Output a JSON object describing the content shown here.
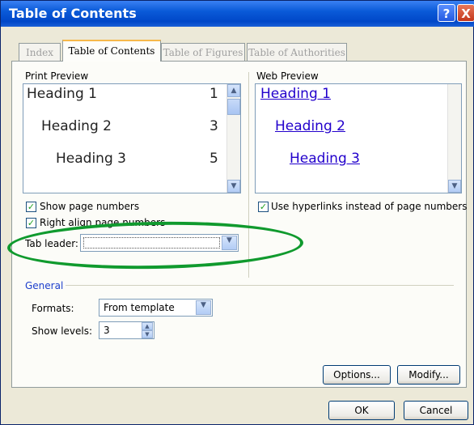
{
  "window": {
    "title": "Table of Contents"
  },
  "titlebar_buttons": {
    "help": "?",
    "close": "X"
  },
  "tabs": [
    {
      "label": "Index"
    },
    {
      "label": "Table of Contents"
    },
    {
      "label": "Table of Figures"
    },
    {
      "label": "Table of Authorities"
    }
  ],
  "print_preview": {
    "label": "Print Preview",
    "headings": [
      {
        "text": "Heading 1",
        "page": "1"
      },
      {
        "text": "Heading 2",
        "page": "3"
      },
      {
        "text": "Heading 3",
        "page": "5"
      }
    ]
  },
  "web_preview": {
    "label": "Web Preview",
    "headings": [
      "Heading 1",
      "Heading 2",
      "Heading 3"
    ]
  },
  "options": {
    "show_page_numbers": {
      "label": "Show page numbers",
      "checked": true
    },
    "right_align": {
      "label": "Right align page numbers",
      "checked": true
    },
    "use_hyperlinks": {
      "label": "Use hyperlinks instead of page numbers",
      "checked": true
    },
    "tab_leader": {
      "label": "Tab leader:",
      "value": ""
    }
  },
  "general": {
    "label": "General",
    "formats": {
      "label": "Formats:",
      "value": "From template"
    },
    "show_levels": {
      "label": "Show levels:",
      "value": "3"
    }
  },
  "buttons": {
    "options": "Options...",
    "modify": "Modify...",
    "ok": "OK",
    "cancel": "Cancel"
  },
  "annotation": {
    "ellipse_color": "#109a2e"
  }
}
